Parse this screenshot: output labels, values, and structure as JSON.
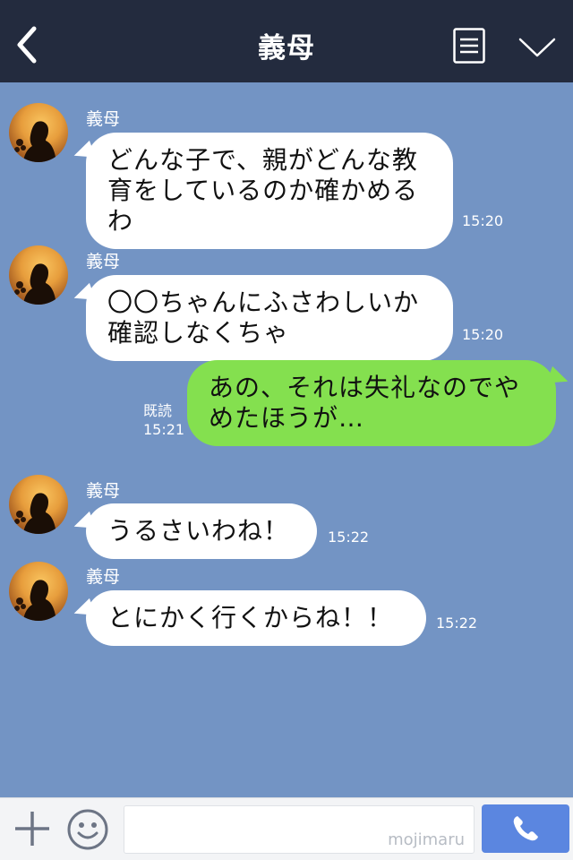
{
  "header": {
    "title": "義母",
    "back_icon": "chevron-left-icon",
    "menu_icon": "list-icon",
    "collapse_icon": "chevron-down-icon"
  },
  "messages": [
    {
      "side": "in",
      "sender": "義母",
      "lines": [
        "どんな子で、親がどんな教",
        "育をしているのか確かめる",
        "わ"
      ],
      "time": "15:20"
    },
    {
      "side": "in",
      "sender": "義母",
      "lines": [
        "〇〇ちゃんにふさわしいか",
        "確認しなくちゃ"
      ],
      "time": "15:20"
    },
    {
      "side": "out",
      "lines": [
        "あの、それは失礼なのでや",
        "めたほうが…"
      ],
      "read": "既読",
      "time": "15:21"
    },
    {
      "side": "in",
      "sender": "義母",
      "lines": [
        "うるさいわね！"
      ],
      "time": "15:22"
    },
    {
      "side": "in",
      "sender": "義母",
      "lines": [
        "とにかく行くからね！！"
      ],
      "time": "15:22"
    }
  ],
  "footer": {
    "plus_icon": "plus-icon",
    "emoji_icon": "smiley-icon",
    "input_value": "",
    "watermark": "mojimaru",
    "call_icon": "phone-icon"
  },
  "colors": {
    "header_bg": "#232b3e",
    "chat_bg": "#7394c4",
    "incoming_bubble": "#ffffff",
    "outgoing_bubble": "#84e04f",
    "call_button": "#5b86e0"
  }
}
